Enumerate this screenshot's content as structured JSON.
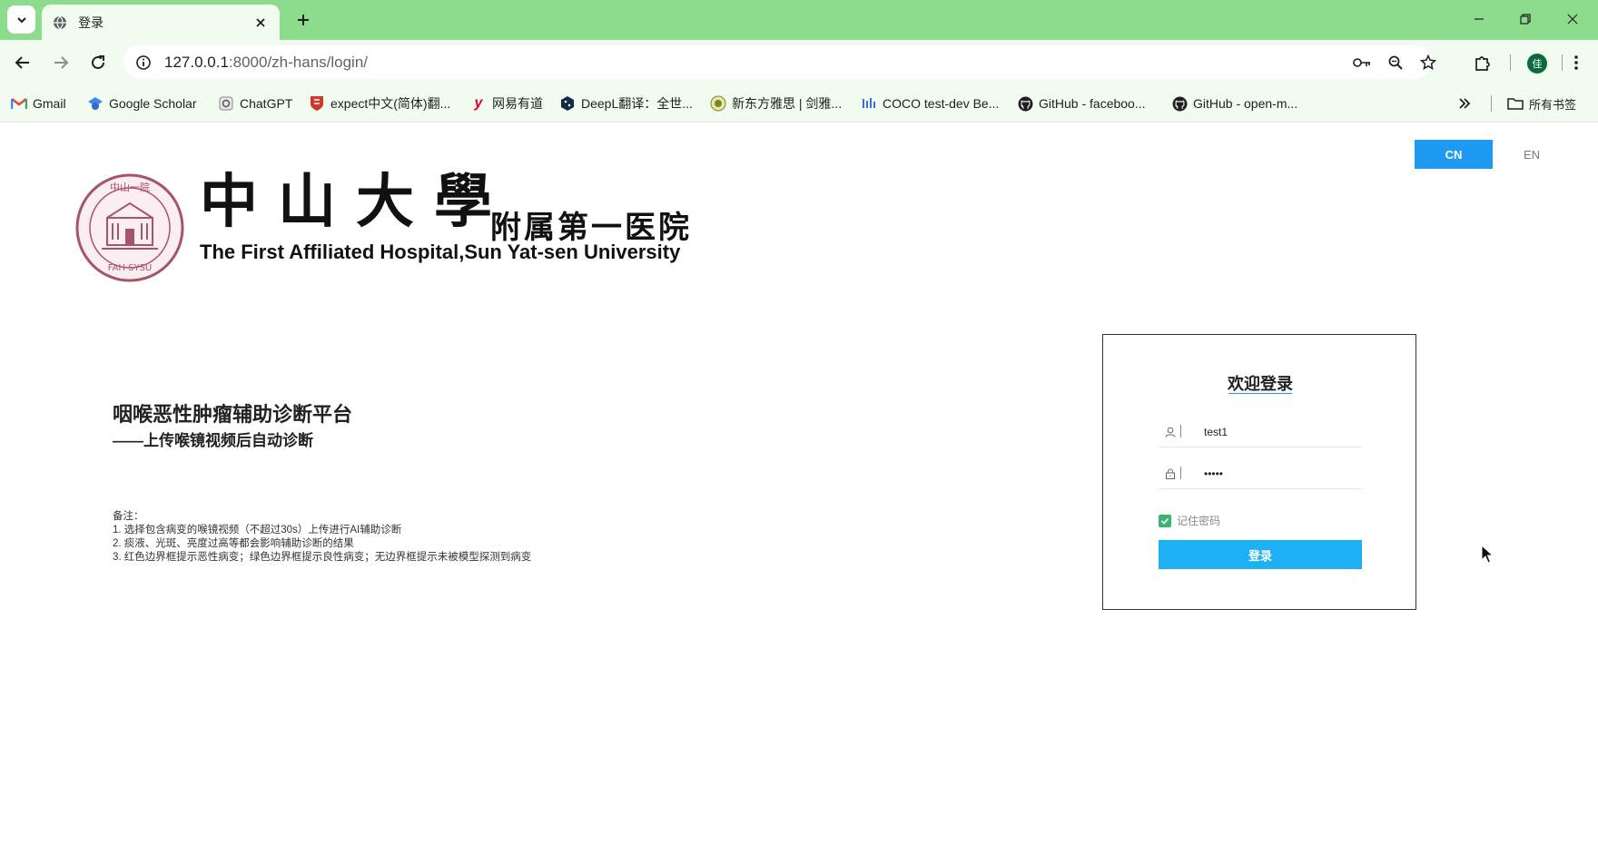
{
  "browser": {
    "tab_title": "登录",
    "url_host": "127.0.0.1",
    "url_path": ":8000/zh-hans/login/",
    "avatar_letter": "佳",
    "bookmarks": [
      {
        "label": "Gmail",
        "icon": "gmail-icon"
      },
      {
        "label": "Google Scholar",
        "icon": "scholar-icon"
      },
      {
        "label": "ChatGPT",
        "icon": "chatgpt-icon"
      },
      {
        "label": "expect中文(简体)翻...",
        "icon": "cambridge-icon"
      },
      {
        "label": "网易有道",
        "icon": "youdao-icon"
      },
      {
        "label": "DeepL翻译：全世...",
        "icon": "deepl-icon"
      },
      {
        "label": "新东方雅思 | 剑雅...",
        "icon": "xdf-icon"
      },
      {
        "label": "COCO test-dev Be...",
        "icon": "coco-icon"
      },
      {
        "label": "GitHub - faceboo...",
        "icon": "github-icon"
      },
      {
        "label": "GitHub - open-m...",
        "icon": "github-icon"
      }
    ],
    "all_bookmarks_label": "所有书签"
  },
  "header": {
    "lang_cn": "CN",
    "lang_en": "EN",
    "logo_cn_big": "中山大學",
    "logo_cn_small": "附属第一医院",
    "logo_en": "The First Affiliated Hospital,Sun Yat-sen University",
    "seal_top_text": "中山一院",
    "seal_bottom_text": "FAH·SYSU"
  },
  "intro": {
    "title": "咽喉恶性肿瘤辅助诊断平台",
    "subtitle": "——上传喉镜视频后自动诊断",
    "notes_heading": "备注：",
    "notes": [
      "1. 选择包含病变的喉镜视频（不超过30s）上传进行AI辅助诊断",
      "2. 痰液、光斑、亮度过高等都会影响辅助诊断的结果",
      "3. 红色边界框提示恶性病变；绿色边界框提示良性病变；无边界框提示未被模型探测到病变"
    ]
  },
  "login": {
    "title": "欢迎登录",
    "username_value": "test1",
    "password_value": "•••••",
    "remember_label": "记住密码",
    "remember_checked": true,
    "submit_label": "登录"
  },
  "colors": {
    "chrome_green": "#8ddc8e",
    "accent_blue": "#1e9bf0",
    "button_blue": "#1eb0f5",
    "checkbox_green": "#3cb371"
  }
}
